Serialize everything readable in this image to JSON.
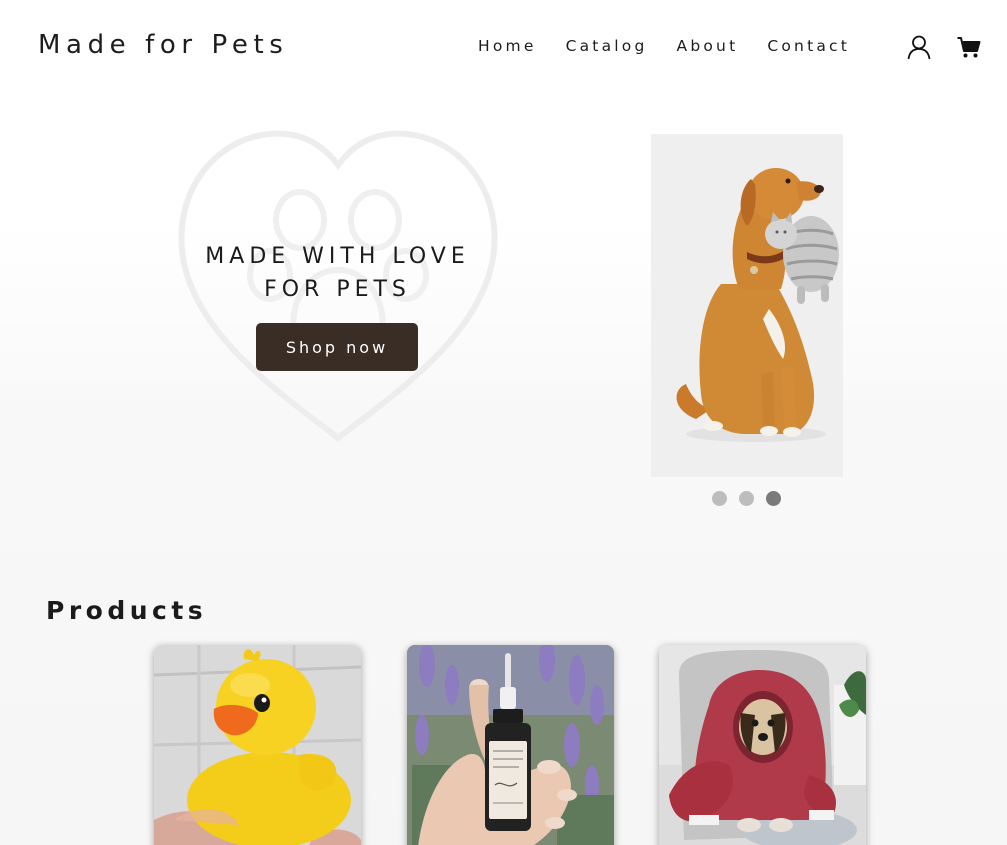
{
  "header": {
    "brand": "Made for Pets",
    "nav": [
      {
        "label": "Home"
      },
      {
        "label": "Catalog"
      },
      {
        "label": "About"
      },
      {
        "label": "Contact"
      }
    ],
    "icons": {
      "account": "user-icon",
      "cart": "cart-icon"
    }
  },
  "hero": {
    "title_line1": "MADE WITH LOVE",
    "title_line2": "FOR PETS",
    "cta_label": "Shop now",
    "cta_color": "#3a2d26",
    "slide_image": "dog-with-toy",
    "slides_total": 3,
    "active_slide": 3
  },
  "products": {
    "title": "Products",
    "items": [
      {
        "image": "rubber-duck"
      },
      {
        "image": "serum-bottle"
      },
      {
        "image": "dog-in-bathrobe"
      }
    ]
  },
  "colors": {
    "accent_dark": "#3a2d26",
    "dot_inactive": "#bdbdbd",
    "dot_active": "#7a7a7a"
  }
}
